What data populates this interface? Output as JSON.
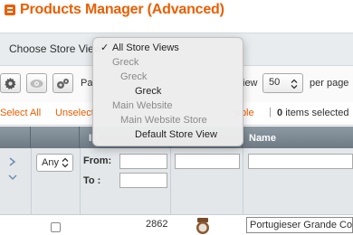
{
  "page": {
    "title": "Products Manager (Advanced)"
  },
  "store_switcher": {
    "label": "Choose Store View:"
  },
  "toolbar": {
    "page_fragment": "Pa",
    "view_fragment": "iew",
    "per_page_value": "50",
    "per_page_label": "per page"
  },
  "mass_select": {
    "select_all": "Select All",
    "unselect": "Unselect",
    "visible_fragment": "sible",
    "separator": "|",
    "items_selected_count": "0",
    "items_selected_label": "items selected"
  },
  "grid": {
    "headers": {
      "id": "ID",
      "name": "Name"
    },
    "filters": {
      "any_value": "Any",
      "from_label": "From:",
      "to_label": "To :"
    },
    "rows": [
      {
        "id": "2862",
        "name": "Portugieser Grande Co"
      }
    ]
  },
  "dropdown": {
    "items": [
      {
        "label": "All Store Views",
        "selected": true,
        "enabled": true,
        "indent": 0
      },
      {
        "label": "Greck",
        "selected": false,
        "enabled": false,
        "indent": 0
      },
      {
        "label": "Greck",
        "selected": false,
        "enabled": false,
        "indent": 1
      },
      {
        "label": "Greck",
        "selected": false,
        "enabled": true,
        "indent": 2
      },
      {
        "label": "Main Website",
        "selected": false,
        "enabled": false,
        "indent": 0
      },
      {
        "label": "Main Website Store",
        "selected": false,
        "enabled": false,
        "indent": 1
      },
      {
        "label": "Default Store View",
        "selected": false,
        "enabled": true,
        "indent": 2
      }
    ]
  },
  "colors": {
    "accent": "#eb5e00",
    "grid_header": "#6d7a84",
    "filter_bg": "#e3e7ea"
  },
  "icons": [
    "page-icon",
    "gear-icon",
    "eye-icon",
    "gears-icon",
    "chevron-down-icon",
    "expand-arrows-icon",
    "checkmark-icon",
    "product-thumbnail"
  ]
}
